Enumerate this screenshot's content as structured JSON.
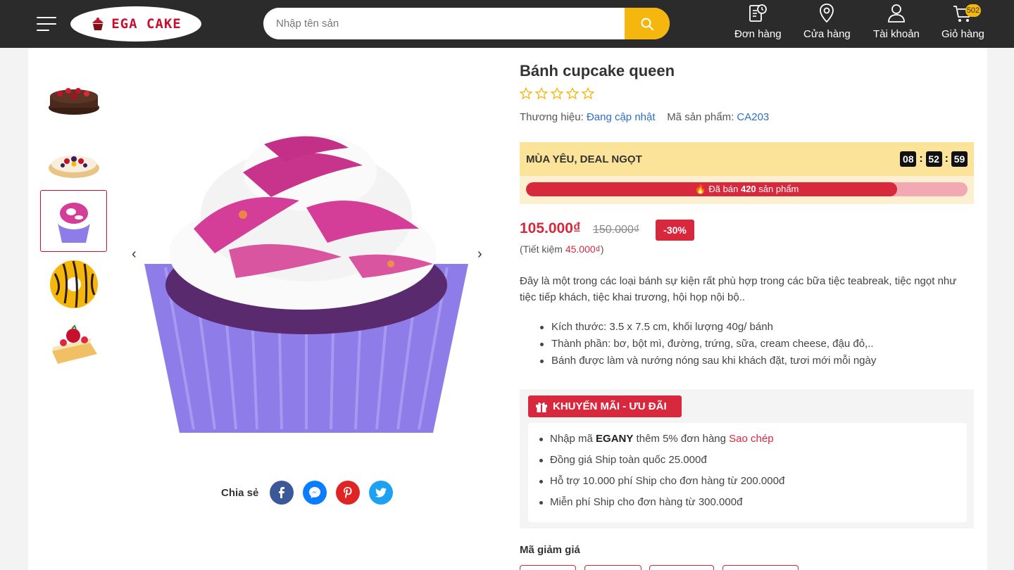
{
  "header": {
    "logo_text": "EGA CAKE",
    "search_placeholder": "Nhập tên sản",
    "nav": [
      {
        "label": "Đơn hàng",
        "icon": "order-icon"
      },
      {
        "label": "Cửa hàng",
        "icon": "location-icon"
      },
      {
        "label": "Tài khoản",
        "icon": "user-icon"
      },
      {
        "label": "Giỏ hàng",
        "icon": "cart-icon"
      }
    ],
    "cart_count": "502",
    "accent": "#f5b70e",
    "bg": "#2b2b2b"
  },
  "gallery": {
    "thumbnails": [
      "chocolate-berry-cake",
      "fruit-tart",
      "cupcake-queen",
      "donut",
      "strawberry-cake-slice"
    ],
    "active_index": 2
  },
  "share": {
    "label": "Chia sẻ",
    "networks": [
      {
        "name": "facebook",
        "color": "#3b5998"
      },
      {
        "name": "messenger",
        "color": "#0a7cff"
      },
      {
        "name": "pinterest",
        "color": "#e02424"
      },
      {
        "name": "twitter",
        "color": "#1da1f2"
      }
    ]
  },
  "product": {
    "title": "Bánh cupcake queen",
    "rating": 0,
    "brand_label": "Thương hiệu:",
    "brand_value": "Đang cập nhật",
    "sku_label": "Mã sản phẩm:",
    "sku_value": "CA203",
    "price": "105.000₫",
    "old_price": "150.000₫",
    "discount": "-30%",
    "save_prefix": "(Tiết kiệm ",
    "save_amount": "45.000₫",
    "save_suffix": ")",
    "description": "Đây là một trong các loại bánh sự kiện rất phù hợp trong các bữa tiệc teabreak, tiệc ngọt như tiệc tiếp khách, tiệc khai trương, hội họp nội bộ..",
    "features": [
      "Kích thước: 3.5 x 7.5 cm, khối lượng 40g/ bánh",
      "Thành phần: bơ, bột mì, đường, trứng, sữa, cream cheese, đậu đỏ,..",
      "Bánh được làm và nướng nóng sau khi khách đặt, tươi mới mỗi ngày"
    ]
  },
  "deal": {
    "title": "MÙA YÊU, DEAL NGỌT",
    "timer": [
      "08",
      "52",
      "59"
    ],
    "sold_prefix": "Đã bán ",
    "sold_count": "420",
    "sold_suffix": " sản phẩm",
    "progress": 0.84
  },
  "promo": {
    "title": "KHUYẾN MÃI - ƯU ĐÃI",
    "item1_prefix": "Nhập mã ",
    "item1_code": "EGANY",
    "item1_suffix": " thêm 5% đơn hàng ",
    "item1_copy": "Sao chép",
    "items": [
      "Đồng giá Ship toàn quốc 25.000đ",
      "Hỗ trợ 10.000 phí Ship cho đơn hàng từ 200.000đ",
      "Miễn phí Ship cho đơn hàng từ 300.000đ"
    ]
  },
  "coupons": {
    "title": "Mã giảm giá"
  }
}
